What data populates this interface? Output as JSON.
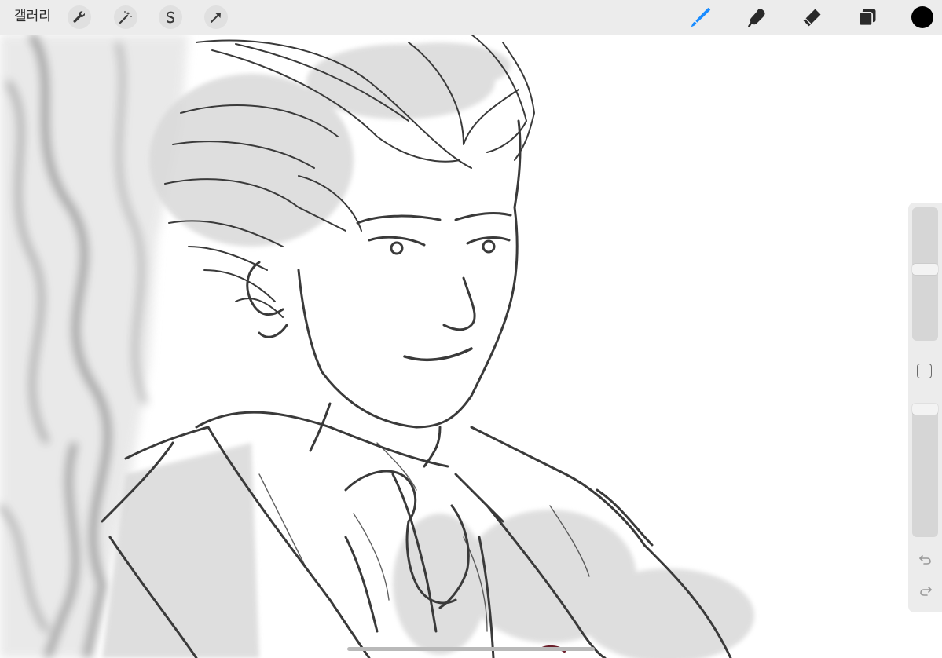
{
  "toolbar": {
    "gallery_label": "갤러리",
    "left_tools": [
      {
        "name": "actions",
        "icon": "wrench-icon"
      },
      {
        "name": "adjustments",
        "icon": "magic-wand-icon"
      },
      {
        "name": "selection",
        "icon": "selection-s-icon"
      },
      {
        "name": "transform",
        "icon": "arrow-cursor-icon"
      }
    ],
    "right_tools": [
      {
        "name": "brush",
        "icon": "brush-icon",
        "active": true
      },
      {
        "name": "smudge",
        "icon": "smudge-icon",
        "active": false
      },
      {
        "name": "eraser",
        "icon": "eraser-icon",
        "active": false
      },
      {
        "name": "layers",
        "icon": "layers-icon",
        "active": false
      }
    ],
    "current_color": "#000000",
    "accent_color": "#1a8cff"
  },
  "sidebar": {
    "brush_size_slider": {
      "icon": "size-slider"
    },
    "modify_button": {
      "icon": "square-modify-icon"
    },
    "opacity_slider": {
      "icon": "opacity-slider"
    },
    "undo": {
      "icon": "undo-icon"
    },
    "redo": {
      "icon": "redo-icon"
    }
  },
  "canvas": {
    "content": "line-art-sketch",
    "line_color": "#3a3a3a",
    "shade_color": "#d9d9d9"
  }
}
